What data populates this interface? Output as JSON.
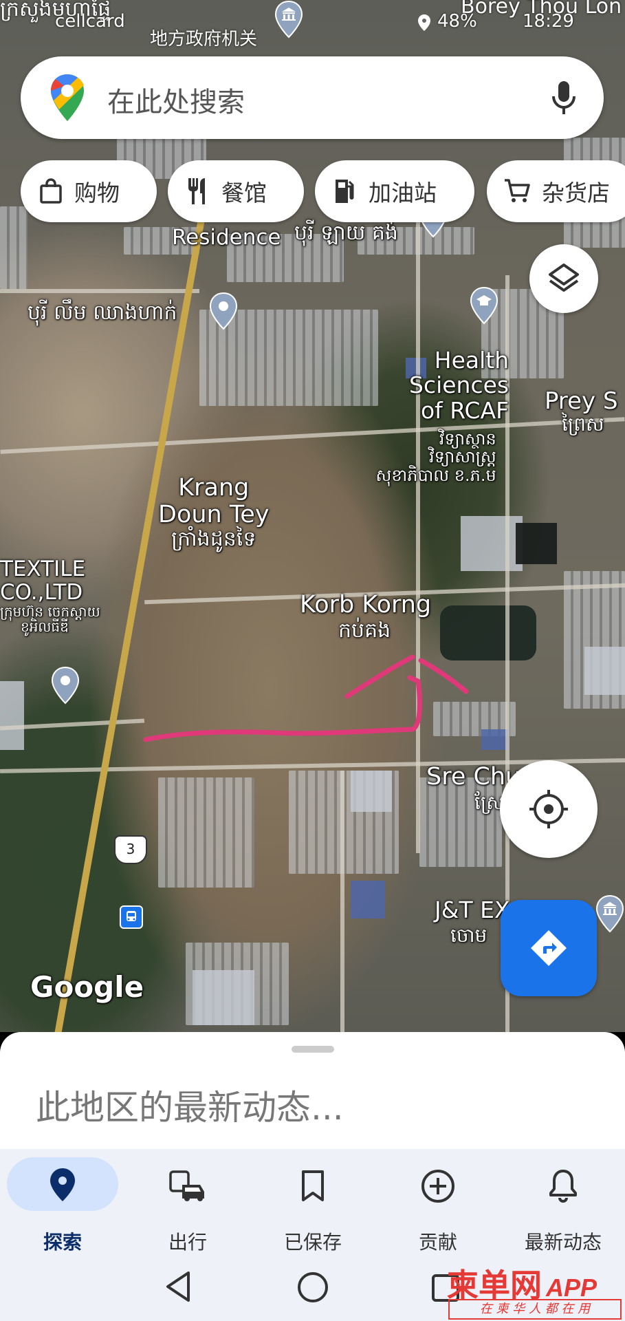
{
  "status_bar": {
    "carrier": "cellcard",
    "battery": "48%",
    "time": "18:29",
    "top_label_cn": "地方政府机关",
    "top_label_km": "ក្រសួងមហាផ្ទៃ",
    "top_label_en": "Borey Thou Lon"
  },
  "search": {
    "placeholder": "在此处搜索"
  },
  "chips": [
    {
      "label": "购物",
      "icon": "shopping-bag-icon"
    },
    {
      "label": "餐馆",
      "icon": "fork-knife-icon"
    },
    {
      "label": "加油站",
      "icon": "gas-pump-icon"
    },
    {
      "label": "杂货店",
      "icon": "cart-icon"
    }
  ],
  "map": {
    "labels": {
      "residence": "Residence",
      "residence_km": "បុរី ឡាយ គង់",
      "borey_leum": "បុរី លឹម ឈាងហាក់",
      "health1": "Health",
      "health2": "Sciences",
      "health3": "of RCAF",
      "health_km1": "វិទ្យាស្ថាន",
      "health_km2": "វិទ្យាសាស្ត្រ",
      "health_km3": "សុខាភិបាល ខ.ភ.ម",
      "prey1": "Prey S",
      "prey_km": "ព្រៃស",
      "krang1": "Krang",
      "krang2": "Doun Tey",
      "krang_km": "ក្រាំងដូនទៃ",
      "textile1": "TEXTILE",
      "textile2": "CO.,LTD",
      "textile_km1": "ក្រុមហ៊ុន ចេកស្ដាយ",
      "textile_km2": "ខូអិលធីឌី",
      "korb": "Korb Korng",
      "korb_km": "កប់គង",
      "sre": "Sre Chumpa",
      "sre_km": "ស្រែ",
      "jt": "J&T EX",
      "jt_km": "ចោម",
      "route": "3",
      "google": "Google"
    }
  },
  "sheet": {
    "title": "此地区的最新动态..."
  },
  "nav": [
    {
      "label": "探索",
      "icon": "explore-pin-icon",
      "active": true
    },
    {
      "label": "出行",
      "icon": "commute-icon",
      "active": false
    },
    {
      "label": "已保存",
      "icon": "bookmark-icon",
      "active": false
    },
    {
      "label": "贡献",
      "icon": "add-circle-icon",
      "active": false
    },
    {
      "label": "最新动态",
      "icon": "bell-icon",
      "active": false
    }
  ],
  "watermark": {
    "main": "柬单网",
    "app": "APP",
    "sub": "在 柬 华 人 都 在 用"
  },
  "colors": {
    "accent": "#1a73e8",
    "nav_active_bg": "#d3e3fd",
    "annotation": "#e0397a",
    "watermark": "#e53935"
  }
}
